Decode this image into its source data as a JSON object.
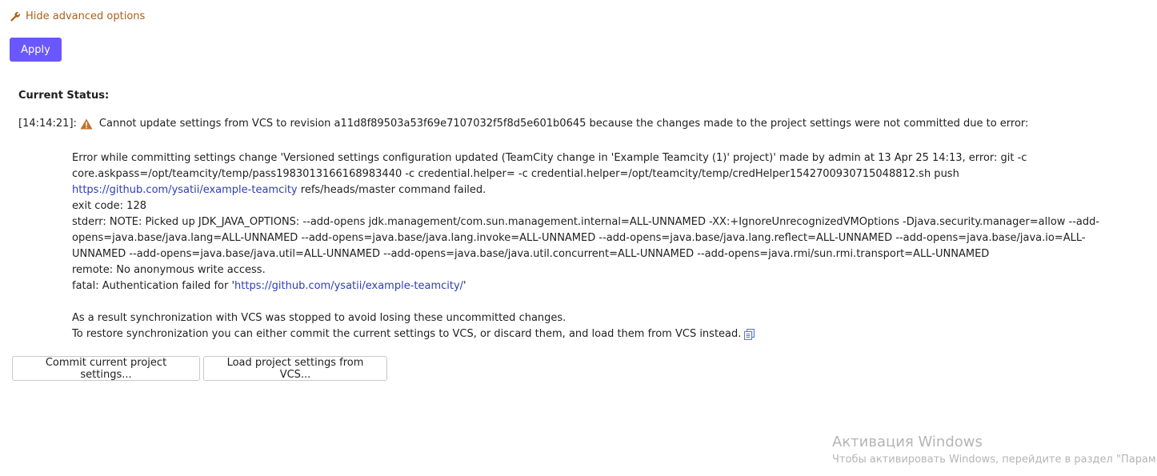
{
  "advanced": {
    "toggle_label": "Hide advanced options"
  },
  "apply_label": "Apply",
  "status": {
    "title": "Current Status:",
    "time": "[14:14:21]:",
    "message": "Cannot update settings from VCS to revision a11d8f89503a53f69e7107032f5f8d5e601b0645 because the changes made to the project settings were not committed due to error:",
    "error": {
      "line1_text": "Error while committing settings change 'Versioned settings configuration updated (TeamCity change in 'Example Teamcity (1)' project)' made by admin at 13 Apr 25 14:13, error: git -c core.askpass=/opt/teamcity/temp/pass1983013166168983440 -c credential.helper= -c credential.helper=/opt/teamcity/temp/credHelper1542700930715048812.sh push ",
      "line1_link": "https://github.com/ysatii/example-teamcity",
      "line1_tail": " refs/heads/master command failed.",
      "exit_code": "exit code: 128",
      "stderr": "stderr: NOTE: Picked up JDK_JAVA_OPTIONS: --add-opens jdk.management/com.sun.management.internal=ALL-UNNAMED -XX:+IgnoreUnrecognizedVMOptions -Djava.security.manager=allow --add-opens=java.base/java.lang=ALL-UNNAMED --add-opens=java.base/java.lang.invoke=ALL-UNNAMED --add-opens=java.base/java.lang.reflect=ALL-UNNAMED --add-opens=java.base/java.io=ALL-UNNAMED --add-opens=java.base/java.util=ALL-UNNAMED --add-opens=java.base/java.util.concurrent=ALL-UNNAMED --add-opens=java.rmi/sun.rmi.transport=ALL-UNNAMED",
      "remote": "remote: No anonymous write access.",
      "fatal_prefix": "fatal: Authentication failed for '",
      "fatal_link": "https://github.com/ysatii/example-teamcity/",
      "fatal_suffix": "'"
    },
    "result_line1": "As a result synchronization with VCS was stopped to avoid losing these uncommitted changes.",
    "result_line2": "To restore synchronization you can either commit the current settings to VCS, or discard them, and load them from VCS instead."
  },
  "buttons": {
    "commit": "Commit current project settings...",
    "load": "Load project settings from VCS..."
  },
  "watermark": {
    "title": "Активация Windows",
    "subtitle": "Чтобы активировать Windows, перейдите в раздел \"Парам"
  },
  "colors": {
    "accent": "#6b57ff",
    "toggle": "#a8621a",
    "link": "#2d3dbb",
    "warning": "#c0702a"
  }
}
